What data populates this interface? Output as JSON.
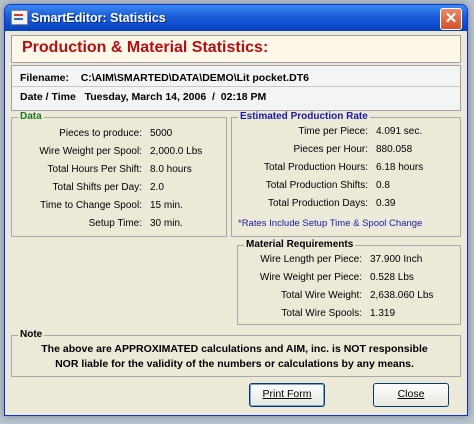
{
  "window": {
    "title": "SmartEditor: Statistics",
    "close_glyph": "✕"
  },
  "banner": {
    "text": "Production & Material Statistics:"
  },
  "file": {
    "filename_label": "Filename:",
    "filename_value": "C:\\AIM\\SMARTED\\DATA\\DEMO\\Lit pocket.DT6",
    "datetime_label": "Date / Time",
    "datetime_value": "Tuesday, March 14, 2006  /  02:18 PM"
  },
  "data_group": {
    "legend": "Data",
    "rows": [
      {
        "label": "Pieces to produce:",
        "value": "5000"
      },
      {
        "label": "Wire Weight per Spool:",
        "value": "2,000.0 Lbs"
      },
      {
        "label": "Total Hours Per Shift:",
        "value": "8.0 hours"
      },
      {
        "label": "Total Shifts per Day:",
        "value": "2.0"
      },
      {
        "label": "Time to Change Spool:",
        "value": "15 min."
      },
      {
        "label": "Setup Time:",
        "value": "30 min."
      }
    ]
  },
  "rate_group": {
    "legend": "Estimated Production Rate",
    "rows": [
      {
        "label": "Time per Piece:",
        "value": "4.091 sec."
      },
      {
        "label": "Pieces per Hour:",
        "value": "880.058"
      },
      {
        "label": "Total Production Hours:",
        "value": "6.18 hours"
      },
      {
        "label": "Total Production Shifts:",
        "value": "0.8"
      },
      {
        "label": "Total Production Days:",
        "value": "0.39"
      }
    ],
    "footnote": "*Rates Include Setup Time & Spool Change"
  },
  "material_group": {
    "legend": "Material Requirements",
    "rows": [
      {
        "label": "Wire Length per Piece:",
        "value": "37.900 Inch"
      },
      {
        "label": "Wire Weight per Piece:",
        "value": "0.528 Lbs"
      },
      {
        "label": "Total Wire Weight:",
        "value": "2,638.060 Lbs"
      },
      {
        "label": "Total Wire Spools:",
        "value": "1.319"
      }
    ]
  },
  "note_group": {
    "legend": "Note",
    "line1": "The above are APPROXIMATED calculations and AIM, inc. is NOT responsible",
    "line2": "NOR liable for the validity of the numbers or calculations by any means."
  },
  "buttons": {
    "print_label": "Print Form",
    "close_label": "Close"
  },
  "colors": {
    "banner_text": "#b50f0f",
    "footnote_text": "#1a1aa8",
    "titlebar": "#0a48c8"
  }
}
